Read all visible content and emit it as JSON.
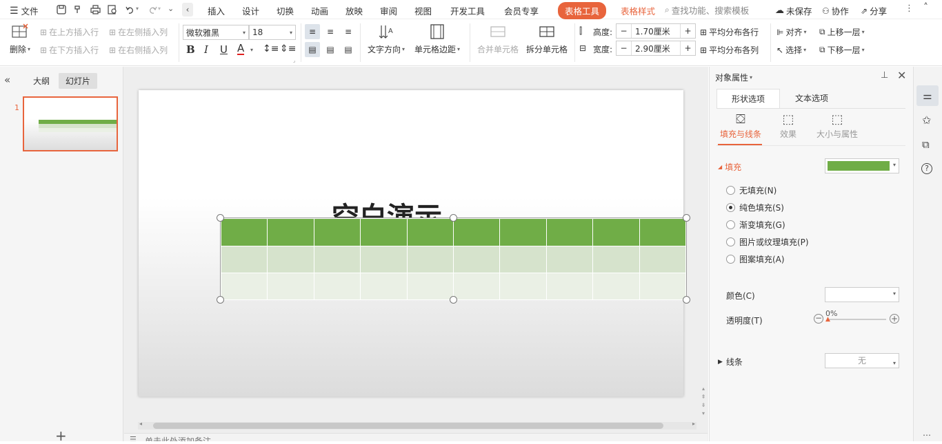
{
  "menu": {
    "file_label": "文件",
    "tabs": [
      "插入",
      "设计",
      "切换",
      "动画",
      "放映",
      "审阅",
      "视图",
      "开发工具",
      "会员专享"
    ],
    "table_tools_tab": "表格工具",
    "table_style_tab": "表格样式",
    "search_placeholder": "查找功能、搜索模板",
    "unsaved_label": "未保存",
    "collab_label": "协作",
    "share_label": "分享"
  },
  "ribbon": {
    "delete_label": "删除",
    "insert_above": "在上方插入行",
    "insert_below": "在下方插入行",
    "insert_left": "在左侧插入列",
    "insert_right": "在右侧插入列",
    "font_name": "微软雅黑",
    "font_size": "18",
    "text_direction": "文字方向",
    "cell_margin": "单元格边距",
    "merge_cells": "合并单元格",
    "split_cells": "拆分单元格",
    "height_label": "高度:",
    "height_value": "1.70厘米",
    "width_label": "宽度:",
    "width_value": "2.90厘米",
    "distribute_rows": "平均分布各行",
    "distribute_cols": "平均分布各列",
    "align_label": "对齐",
    "select_label": "选择",
    "bring_forward": "上移一层",
    "send_backward": "下移一层"
  },
  "left_panel": {
    "outline_tab": "大纲",
    "slides_tab": "幻灯片",
    "slide_number": "1"
  },
  "slide": {
    "title_text": "空白演示",
    "table_header_color": "#70ad47",
    "table_row1_color": "#d6e3cc",
    "table_row2_color": "#eaf0e5"
  },
  "notes": {
    "placeholder": "单击此处添加备注"
  },
  "properties": {
    "title": "对象属性",
    "tab_shape": "形状选项",
    "tab_text": "文本选项",
    "sub_fill_line": "填充与线条",
    "sub_effect": "效果",
    "sub_size": "大小与属性",
    "fill_section": "填充",
    "fill_color": "#70ad47",
    "fill_options": [
      "无填充(N)",
      "纯色填充(S)",
      "渐变填充(G)",
      "图片或纹理填充(P)",
      "图案填充(A)"
    ],
    "selected_fill_option": "纯色填充(S)",
    "color_label": "颜色(C)",
    "transparency_label": "透明度(T)",
    "transparency_value": "0%",
    "line_section": "线条",
    "line_value": "无"
  },
  "colors": {
    "accent": "#e8643c",
    "table_green": "#70ad47"
  }
}
